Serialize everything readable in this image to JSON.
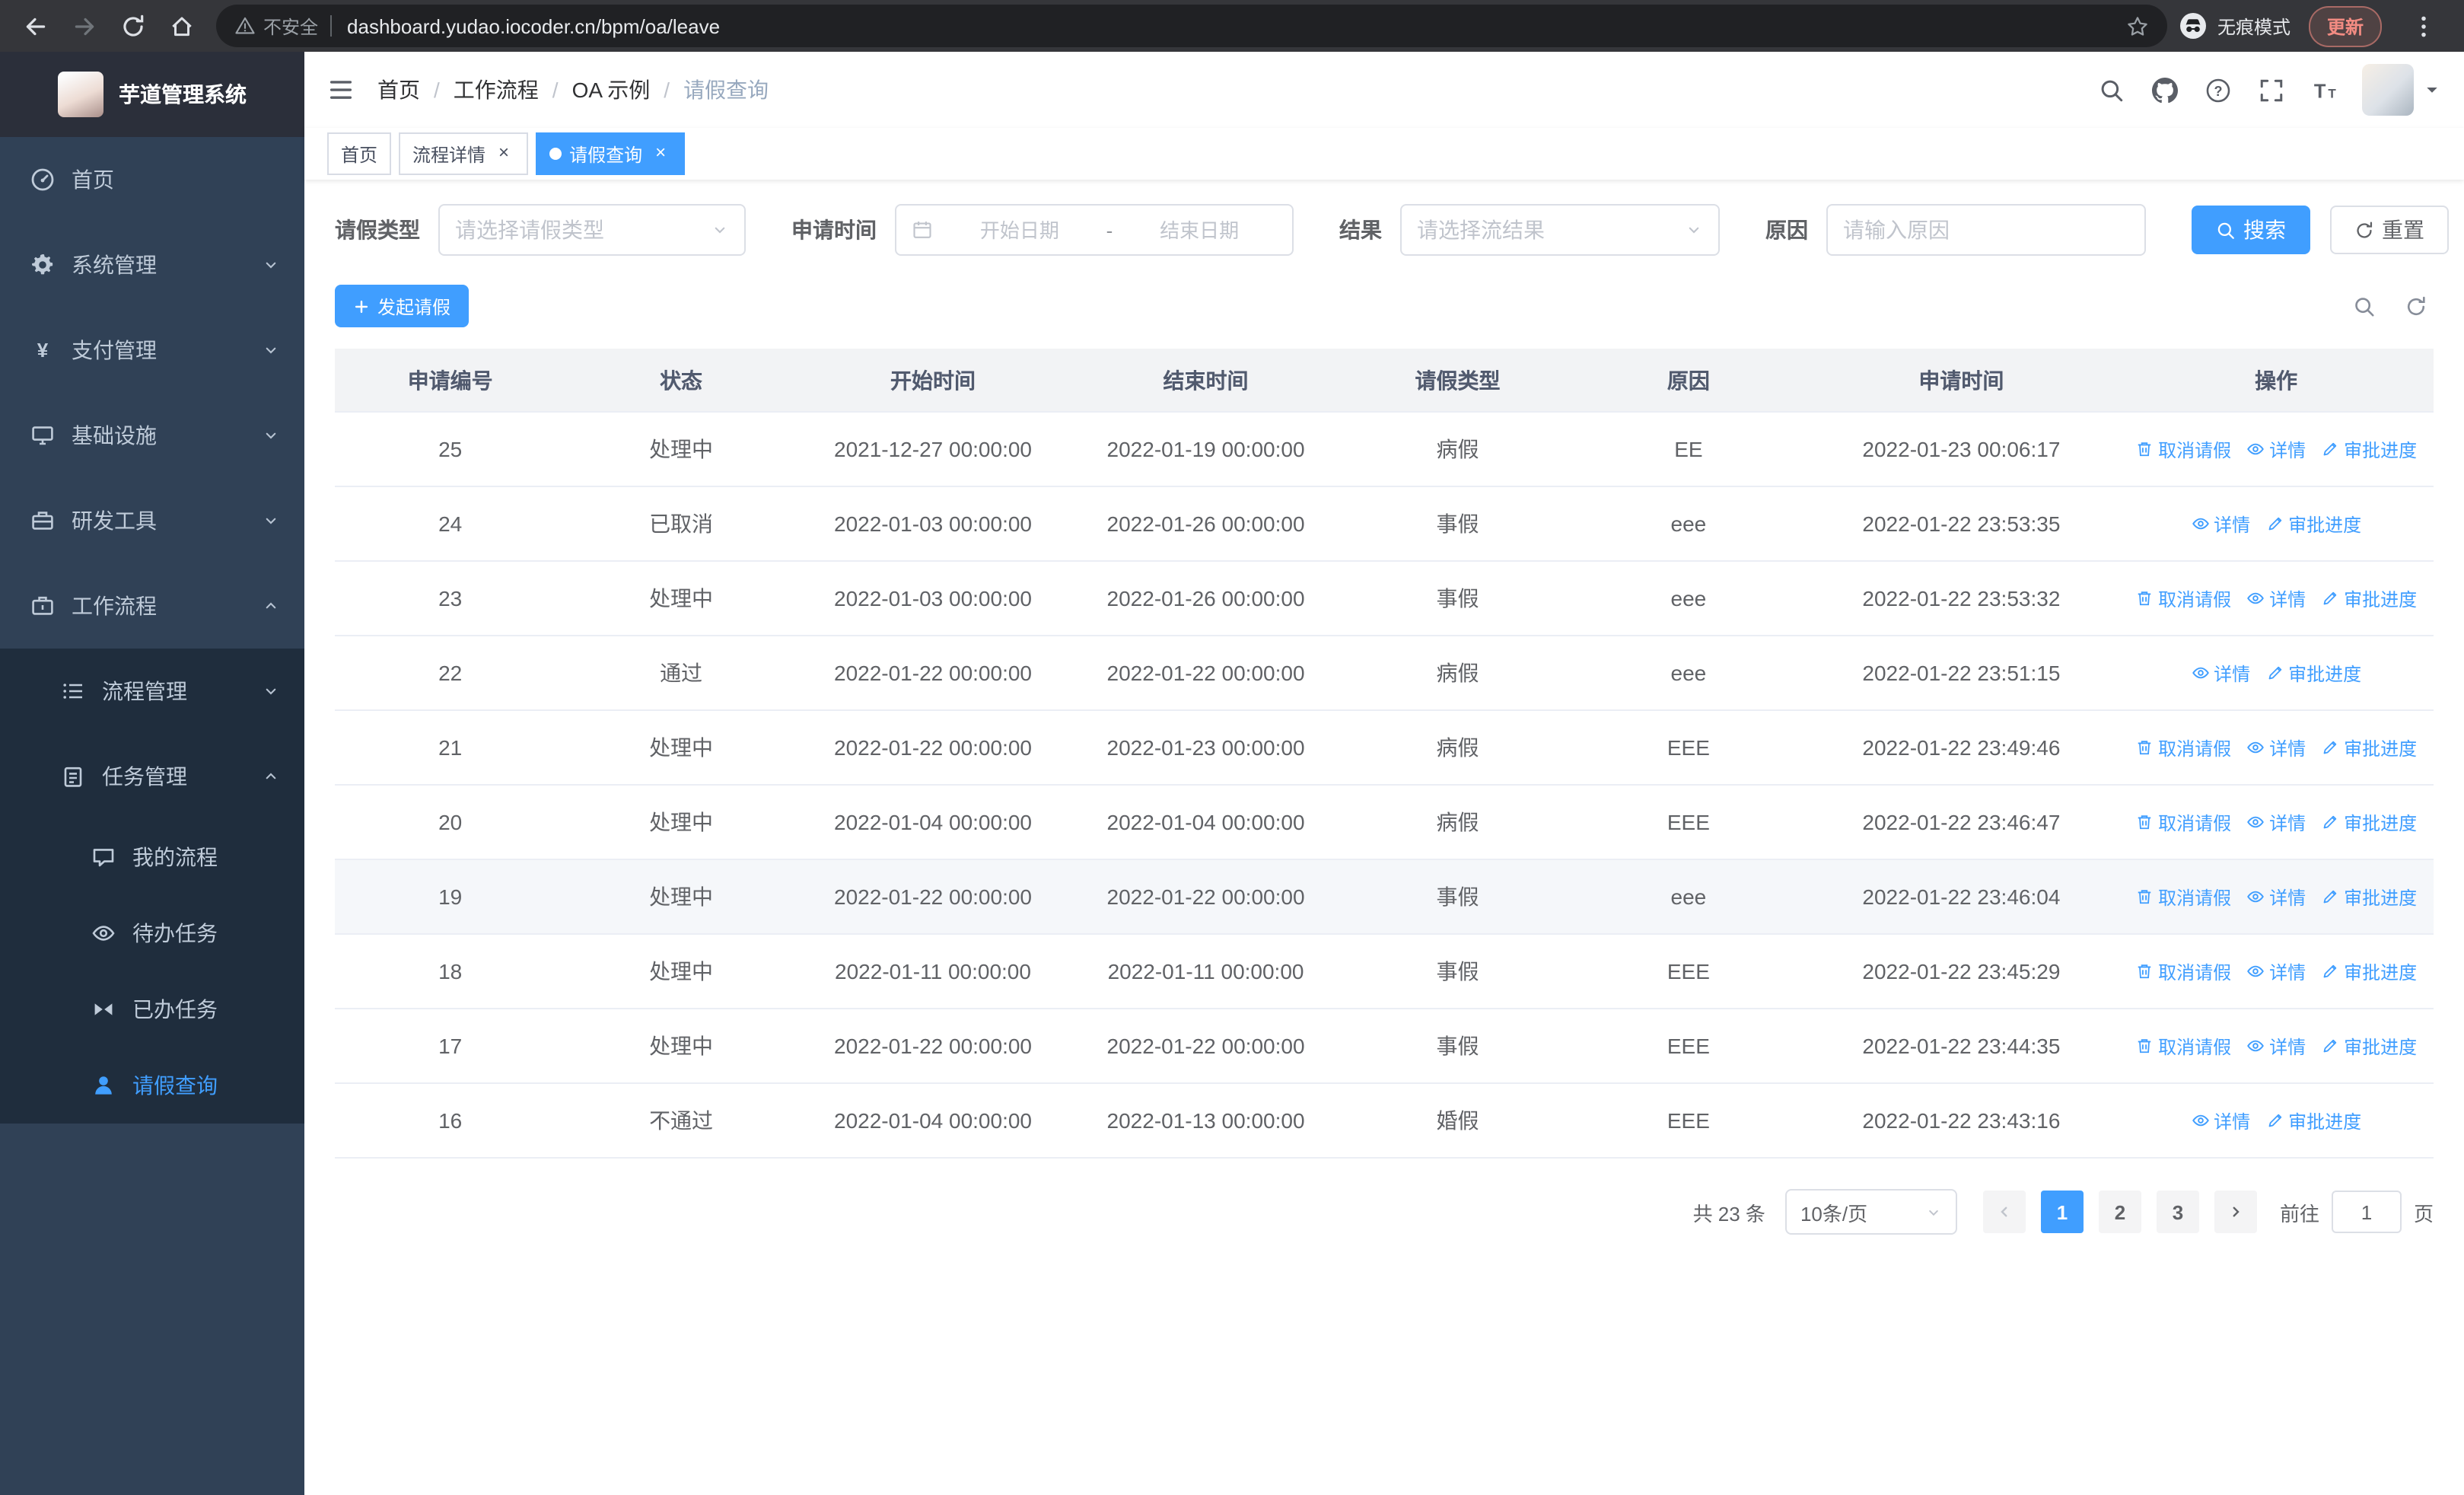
{
  "colors": {
    "primary": "#409eff",
    "sidebar_bg": "#304156",
    "submenu_bg": "#1f2d3d"
  },
  "browser": {
    "nav_icons": [
      "back-icon",
      "forward-icon",
      "reload-icon",
      "home-icon"
    ],
    "security_label": "不安全",
    "url": "dashboard.yudao.iocoder.cn/bpm/oa/leave",
    "incognito_label": "无痕模式",
    "update_label": "更新"
  },
  "sidebar": {
    "logo_title": "芋道管理系统",
    "items": [
      {
        "key": "home",
        "label": "首页",
        "icon": "dashboard-icon",
        "type": "item"
      },
      {
        "key": "system",
        "label": "系统管理",
        "icon": "gear-icon",
        "type": "submenu",
        "state": "collapsed"
      },
      {
        "key": "payment",
        "label": "支付管理",
        "icon": "yen-icon",
        "type": "submenu",
        "state": "collapsed"
      },
      {
        "key": "infra",
        "label": "基础设施",
        "icon": "monitor-icon",
        "type": "submenu",
        "state": "collapsed"
      },
      {
        "key": "devtools",
        "label": "研发工具",
        "icon": "toolbox-icon",
        "type": "submenu",
        "state": "collapsed"
      },
      {
        "key": "workflow",
        "label": "工作流程",
        "icon": "briefcase-icon",
        "type": "submenu",
        "state": "expanded"
      }
    ],
    "workflow_children": [
      {
        "key": "process-mgmt",
        "label": "流程管理",
        "icon": "list-icon",
        "type": "submenu",
        "state": "collapsed"
      },
      {
        "key": "task-mgmt",
        "label": "任务管理",
        "icon": "clipboard-icon",
        "type": "submenu",
        "state": "expanded"
      }
    ],
    "task_children": [
      {
        "key": "my-process",
        "label": "我的流程",
        "icon": "chat-icon"
      },
      {
        "key": "todo-task",
        "label": "待办任务",
        "icon": "eye-icon"
      },
      {
        "key": "done-task",
        "label": "已办任务",
        "icon": "bowtie-icon"
      },
      {
        "key": "leave-query",
        "label": "请假查询",
        "icon": "user-icon",
        "active": true
      }
    ]
  },
  "header": {
    "breadcrumb": [
      "首页",
      "工作流程",
      "OA 示例",
      "请假查询"
    ],
    "navbar_icons": [
      "search-icon",
      "github-icon",
      "help-icon",
      "fullscreen-icon",
      "font-size-icon"
    ]
  },
  "tabs": [
    {
      "key": "home",
      "label": "首页",
      "active": false,
      "closable": false
    },
    {
      "key": "process-detail",
      "label": "流程详情",
      "active": false,
      "closable": true
    },
    {
      "key": "leave-query",
      "label": "请假查询",
      "active": true,
      "closable": true
    }
  ],
  "filters": {
    "leave_type_label": "请假类型",
    "leave_type_placeholder": "请选择请假类型",
    "apply_time_label": "申请时间",
    "start_date_placeholder": "开始日期",
    "date_separator": "-",
    "end_date_placeholder": "结束日期",
    "result_label": "结果",
    "result_placeholder": "请选择流结果",
    "reason_label": "原因",
    "reason_placeholder": "请输入原因",
    "search_label": "搜索",
    "reset_label": "重置"
  },
  "toolbar": {
    "create_label": "发起请假"
  },
  "table": {
    "columns": [
      "申请编号",
      "状态",
      "开始时间",
      "结束时间",
      "请假类型",
      "原因",
      "申请时间",
      "操作"
    ],
    "actions": {
      "cancel": {
        "label": "取消请假",
        "icon": "trash-icon"
      },
      "detail": {
        "label": "详情",
        "icon": "eye-icon"
      },
      "progress": {
        "label": "审批进度",
        "icon": "edit-icon"
      }
    },
    "rows": [
      {
        "id": "25",
        "status": "处理中",
        "start": "2021-12-27 00:00:00",
        "end": "2022-01-19 00:00:00",
        "type": "病假",
        "reason": "EE",
        "applied": "2022-01-23 00:06:17",
        "can_cancel": true,
        "highlighted": false
      },
      {
        "id": "24",
        "status": "已取消",
        "start": "2022-01-03 00:00:00",
        "end": "2022-01-26 00:00:00",
        "type": "事假",
        "reason": "eee",
        "applied": "2022-01-22 23:53:35",
        "can_cancel": false,
        "highlighted": false
      },
      {
        "id": "23",
        "status": "处理中",
        "start": "2022-01-03 00:00:00",
        "end": "2022-01-26 00:00:00",
        "type": "事假",
        "reason": "eee",
        "applied": "2022-01-22 23:53:32",
        "can_cancel": true,
        "highlighted": false
      },
      {
        "id": "22",
        "status": "通过",
        "start": "2022-01-22 00:00:00",
        "end": "2022-01-22 00:00:00",
        "type": "病假",
        "reason": "eee",
        "applied": "2022-01-22 23:51:15",
        "can_cancel": false,
        "highlighted": false
      },
      {
        "id": "21",
        "status": "处理中",
        "start": "2022-01-22 00:00:00",
        "end": "2022-01-23 00:00:00",
        "type": "病假",
        "reason": "EEE",
        "applied": "2022-01-22 23:49:46",
        "can_cancel": true,
        "highlighted": false
      },
      {
        "id": "20",
        "status": "处理中",
        "start": "2022-01-04 00:00:00",
        "end": "2022-01-04 00:00:00",
        "type": "病假",
        "reason": "EEE",
        "applied": "2022-01-22 23:46:47",
        "can_cancel": true,
        "highlighted": false
      },
      {
        "id": "19",
        "status": "处理中",
        "start": "2022-01-22 00:00:00",
        "end": "2022-01-22 00:00:00",
        "type": "事假",
        "reason": "eee",
        "applied": "2022-01-22 23:46:04",
        "can_cancel": true,
        "highlighted": true
      },
      {
        "id": "18",
        "status": "处理中",
        "start": "2022-01-11 00:00:00",
        "end": "2022-01-11 00:00:00",
        "type": "事假",
        "reason": "EEE",
        "applied": "2022-01-22 23:45:29",
        "can_cancel": true,
        "highlighted": false
      },
      {
        "id": "17",
        "status": "处理中",
        "start": "2022-01-22 00:00:00",
        "end": "2022-01-22 00:00:00",
        "type": "事假",
        "reason": "EEE",
        "applied": "2022-01-22 23:44:35",
        "can_cancel": true,
        "highlighted": false
      },
      {
        "id": "16",
        "status": "不通过",
        "start": "2022-01-04 00:00:00",
        "end": "2022-01-13 00:00:00",
        "type": "婚假",
        "reason": "EEE",
        "applied": "2022-01-22 23:43:16",
        "can_cancel": false,
        "highlighted": false
      }
    ]
  },
  "pagination": {
    "total_text": "共 23 条",
    "page_size": "10条/页",
    "pages": [
      "1",
      "2",
      "3"
    ],
    "active_page": "1",
    "goto_label": "前往",
    "goto_value": "1",
    "page_label": "页"
  }
}
